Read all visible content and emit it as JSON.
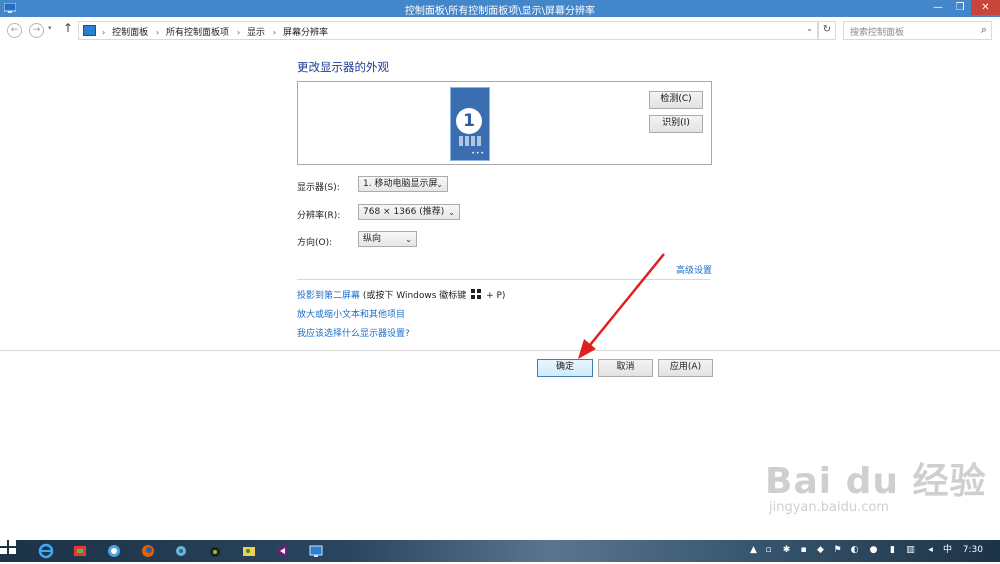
{
  "window": {
    "title": "控制面板\\所有控制面板项\\显示\\屏幕分辨率",
    "minimize": "—",
    "maximize": "❐",
    "close": "✕"
  },
  "nav": {
    "back": "←",
    "forward": "→",
    "history": "▾",
    "up": "↑",
    "breadcrumbs": [
      "控制面板",
      "所有控制面板项",
      "显示",
      "屏幕分辨率"
    ],
    "separator": "›",
    "dropdown": "⌄",
    "refresh": "↻",
    "search_placeholder": "搜索控制面板",
    "search_icon": "⌕"
  },
  "main": {
    "title": "更改显示器的外观",
    "monitor_number": "1",
    "detect_button": "检测(C)",
    "identify_button": "识别(I)",
    "display_label": "显示器(S):",
    "display_value": "1. 移动电脑显示屏",
    "resolution_label": "分辨率(R):",
    "resolution_value": "768 × 1366 (推荐)",
    "orientation_label": "方向(O):",
    "orientation_value": "纵向",
    "advanced_link": "高级设置",
    "project_link": "投影到第二屏幕",
    "project_hint_prefix": "(或按下 Windows 徽标键",
    "project_hint_suffix": "+ P)",
    "text_size_link": "放大或缩小文本和其他项目",
    "which_settings_link": "我应该选择什么显示器设置?",
    "ok_button": "确定",
    "cancel_button": "取消",
    "apply_button": "应用(A)"
  },
  "watermark": {
    "main": "Bai du 经验",
    "sub": "jingyan.baidu.com"
  },
  "taskbar": {
    "apps": [
      "ie-icon",
      "app-icon",
      "browser-icon",
      "firefox-icon",
      "network-icon",
      "media-icon",
      "photo-icon",
      "visual-studio-icon",
      "control-panel-icon"
    ],
    "clock": "7:30",
    "ime": "中"
  },
  "colors": {
    "titlebar": "#4386c9",
    "close": "#c7453a",
    "link": "#1a6fc9",
    "heading": "#1f3b99",
    "arrow": "#e02020"
  }
}
